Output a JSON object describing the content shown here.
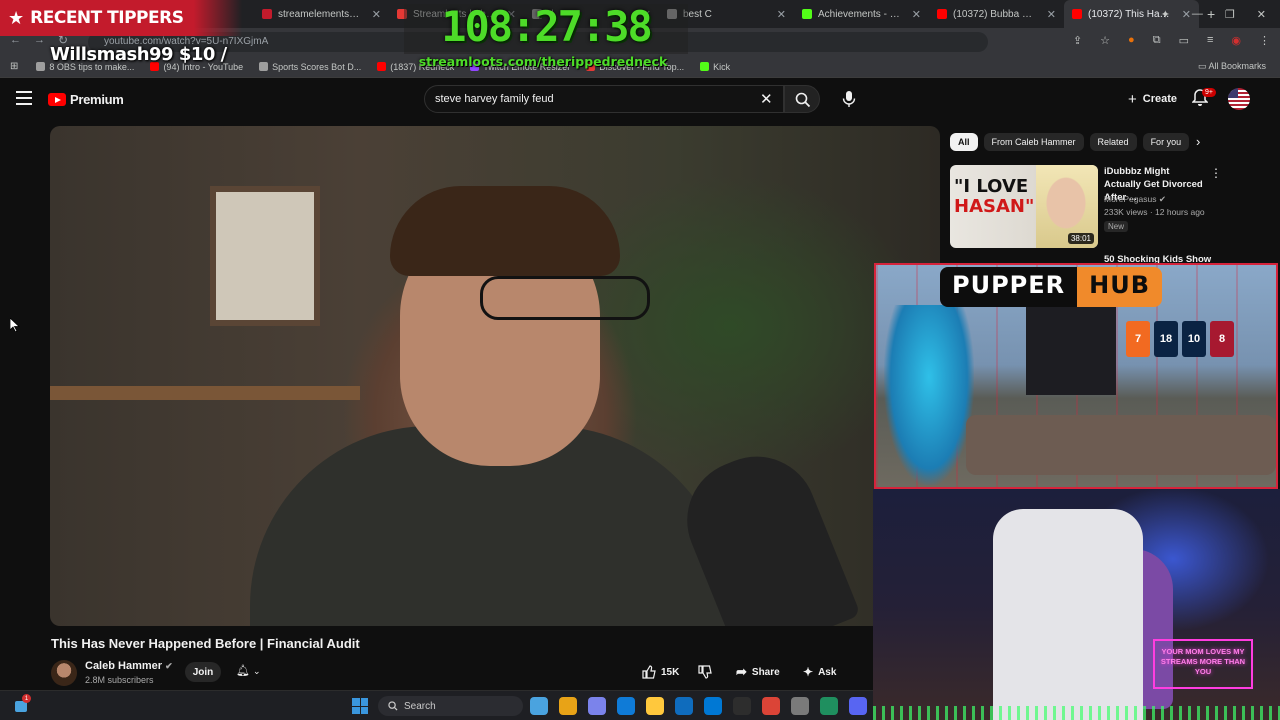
{
  "browser": {
    "tabs": [
      {
        "label": "streamelements - rippedr",
        "color": "#c31b2c"
      },
      {
        "label": "Streamloots | Therippedr",
        "color": "#e53935"
      },
      {
        "label": "d",
        "color": "#9e9e9e"
      },
      {
        "label": "best C",
        "color": "#9e9e9e"
      },
      {
        "label": "Achievements - Kick Dash",
        "color": "#53fc18"
      },
      {
        "label": "(10372) Bubba Shot The",
        "color": "#ff0000"
      },
      {
        "label": "(10372) This Has Nev",
        "color": "#ff0000",
        "active": true
      }
    ],
    "new_tab": "+",
    "url": "youtube.com/watch?v=5U-n7IXGjmA",
    "bookmarks": [
      {
        "label": "8 OBS tips to make...",
        "color": "#9e9e9e"
      },
      {
        "label": "(94) Intro - YouTube",
        "color": "#ff0000"
      },
      {
        "label": "Sports Scores Bot D...",
        "color": "#9e9e9e"
      },
      {
        "label": "(1837) Redneck",
        "color": "#ff0000"
      },
      {
        "label": "Twitch Emote Resizer",
        "color": "#9146ff"
      },
      {
        "label": "Discover - Find Top...",
        "color": "#e53935"
      },
      {
        "label": "Kick",
        "color": "#53fc18"
      }
    ],
    "all_bookmarks": "All Bookmarks"
  },
  "youtube": {
    "logo_text": "Premium",
    "search_value": "steve harvey family feud",
    "create_label": "Create",
    "notif_badge": "9+"
  },
  "video": {
    "title": "This Has Never Happened Before | Financial Audit",
    "channel": "Caleb Hammer",
    "subscribers": "2.8M subscribers",
    "join_label": "Join",
    "likes": "15K",
    "share_label": "Share",
    "ask_label": "Ask"
  },
  "sidebar": {
    "chips": [
      "All",
      "From Caleb Hammer",
      "Related",
      "For you"
    ],
    "rec1": {
      "title": "iDubbbz Might Actually Get Divorced After ...",
      "channel": "MorePegasus",
      "meta": "233K views · 12 hours ago",
      "badge": "New",
      "duration": "38:01",
      "thumb_text_1": "\"I LOVE",
      "thumb_text_2": "HASAN\""
    },
    "rec2": {
      "title": "50 Shocking Kids Show"
    }
  },
  "overlay": {
    "tippers_label": "RECENT TIPPERS",
    "tipper_entry": "Willsmash99 $10 /",
    "timer": "108:27:38",
    "promo_url": "streamloots.com/therippedredneck",
    "pupper_left": "PUPPER",
    "pupper_right": "HUB",
    "jerseys": [
      {
        "number": "7",
        "color": "#f26a21"
      },
      {
        "number": "18",
        "color": "#0a2343"
      },
      {
        "number": "10",
        "color": "#0a2343"
      },
      {
        "number": "8",
        "color": "#a71930"
      }
    ],
    "neon_sign": "YOUR MOM LOVES MY STREAMS MORE THAN YOU"
  },
  "taskbar": {
    "search_label": "Search",
    "widget_badge": "1",
    "apps": [
      "#4aa3df",
      "#e8a317",
      "#7b83eb",
      "#0f7bd7",
      "#ffc83d",
      "#0f6cbd",
      "#0078d4",
      "#2d2d2d",
      "#db4437",
      "#7a7a7a",
      "#1f8f5f",
      "#5865f2"
    ]
  }
}
